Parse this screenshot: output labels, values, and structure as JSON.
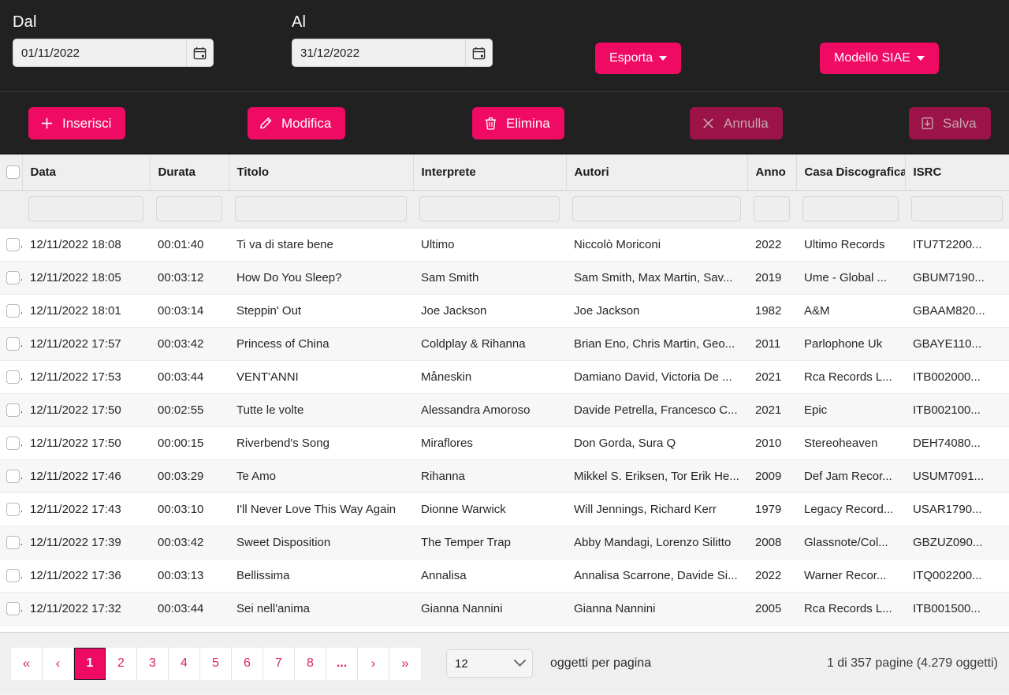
{
  "header": {
    "from": {
      "label": "Dal",
      "value": "01/11/2022",
      "icon": "calendar-icon"
    },
    "to": {
      "label": "Al",
      "value": "31/12/2022",
      "icon": "calendar-icon"
    },
    "export_button": "Esporta",
    "siae_button": "Modello SIAE"
  },
  "toolbar": {
    "insert": {
      "label": "Inserisci",
      "icon": "plus-icon",
      "enabled": true
    },
    "edit": {
      "label": "Modifica",
      "icon": "pencil-icon",
      "enabled": true
    },
    "delete": {
      "label": "Elimina",
      "icon": "trash-icon",
      "enabled": true
    },
    "cancel": {
      "label": "Annulla",
      "icon": "close-icon",
      "enabled": false
    },
    "save": {
      "label": "Salva",
      "icon": "save-icon",
      "enabled": false
    }
  },
  "table": {
    "columns": [
      "Data",
      "Durata",
      "Titolo",
      "Interprete",
      "Autori",
      "Anno",
      "Casa Discografica",
      "ISRC"
    ],
    "filter_placeholder": "",
    "rows": [
      {
        "data": "12/11/2022 18:08",
        "durata": "00:01:40",
        "titolo": "Ti va di stare bene",
        "interprete": "Ultimo",
        "autori": "Niccolò Moriconi",
        "anno": "2022",
        "casa": "Ultimo Records",
        "isrc": "ITU7T2200..."
      },
      {
        "data": "12/11/2022 18:05",
        "durata": "00:03:12",
        "titolo": "How Do You Sleep?",
        "interprete": "Sam Smith",
        "autori": "Sam Smith, Max Martin, Sav...",
        "anno": "2019",
        "casa": "Ume - Global ...",
        "isrc": "GBUM7190..."
      },
      {
        "data": "12/11/2022 18:01",
        "durata": "00:03:14",
        "titolo": "Steppin' Out",
        "interprete": "Joe Jackson",
        "autori": "Joe Jackson",
        "anno": "1982",
        "casa": "A&M",
        "isrc": "GBAAM820..."
      },
      {
        "data": "12/11/2022 17:57",
        "durata": "00:03:42",
        "titolo": "Princess of China",
        "interprete": "Coldplay & Rihanna",
        "autori": "Brian Eno, Chris Martin, Geo...",
        "anno": "2011",
        "casa": "Parlophone Uk",
        "isrc": "GBAYE110..."
      },
      {
        "data": "12/11/2022 17:53",
        "durata": "00:03:44",
        "titolo": "VENT'ANNI",
        "interprete": "Måneskin",
        "autori": "Damiano David, Victoria De ...",
        "anno": "2021",
        "casa": "Rca Records L...",
        "isrc": "ITB002000..."
      },
      {
        "data": "12/11/2022 17:50",
        "durata": "00:02:55",
        "titolo": "Tutte le volte",
        "interprete": "Alessandra Amoroso",
        "autori": "Davide Petrella, Francesco C...",
        "anno": "2021",
        "casa": "Epic",
        "isrc": "ITB002100..."
      },
      {
        "data": "12/11/2022 17:50",
        "durata": "00:00:15",
        "titolo": "Riverbend's Song",
        "interprete": "Miraflores",
        "autori": "Don Gorda, Sura Q",
        "anno": "2010",
        "casa": "Stereoheaven",
        "isrc": "DEH74080..."
      },
      {
        "data": "12/11/2022 17:46",
        "durata": "00:03:29",
        "titolo": "Te Amo",
        "interprete": "Rihanna",
        "autori": "Mikkel S. Eriksen, Tor Erik He...",
        "anno": "2009",
        "casa": "Def Jam Recor...",
        "isrc": "USUM7091..."
      },
      {
        "data": "12/11/2022 17:43",
        "durata": "00:03:10",
        "titolo": "I'll Never Love This Way Again",
        "interprete": "Dionne Warwick",
        "autori": "Will Jennings, Richard Kerr",
        "anno": "1979",
        "casa": "Legacy Record...",
        "isrc": "USAR1790..."
      },
      {
        "data": "12/11/2022 17:39",
        "durata": "00:03:42",
        "titolo": "Sweet Disposition",
        "interprete": "The Temper Trap",
        "autori": "Abby Mandagi, Lorenzo Silitto",
        "anno": "2008",
        "casa": "Glassnote/Col...",
        "isrc": "GBZUZ090..."
      },
      {
        "data": "12/11/2022 17:36",
        "durata": "00:03:13",
        "titolo": "Bellissima",
        "interprete": "Annalisa",
        "autori": "Annalisa Scarrone, Davide Si...",
        "anno": "2022",
        "casa": "Warner Recor...",
        "isrc": "ITQ002200..."
      },
      {
        "data": "12/11/2022 17:32",
        "durata": "00:03:44",
        "titolo": "Sei nell'anima",
        "interprete": "Gianna Nannini",
        "autori": "Gianna Nannini",
        "anno": "2005",
        "casa": "Rca Records L...",
        "isrc": "ITB001500..."
      }
    ]
  },
  "pagination": {
    "first": "«",
    "prev": "‹",
    "pages": [
      "1",
      "2",
      "3",
      "4",
      "5",
      "6",
      "7",
      "8"
    ],
    "ellipsis": "...",
    "next": "›",
    "last": "»",
    "active_page": "1",
    "per_page_value": "12",
    "per_page_label": "oggetti per pagina",
    "summary": "1 di 357 pagine (4.279 oggetti)"
  },
  "colors": {
    "accent": "#ef0a63",
    "accent_disabled": "#9c1447",
    "dark_bar": "#212121",
    "header_grey": "#efefef",
    "pager_link": "#d6246b"
  }
}
